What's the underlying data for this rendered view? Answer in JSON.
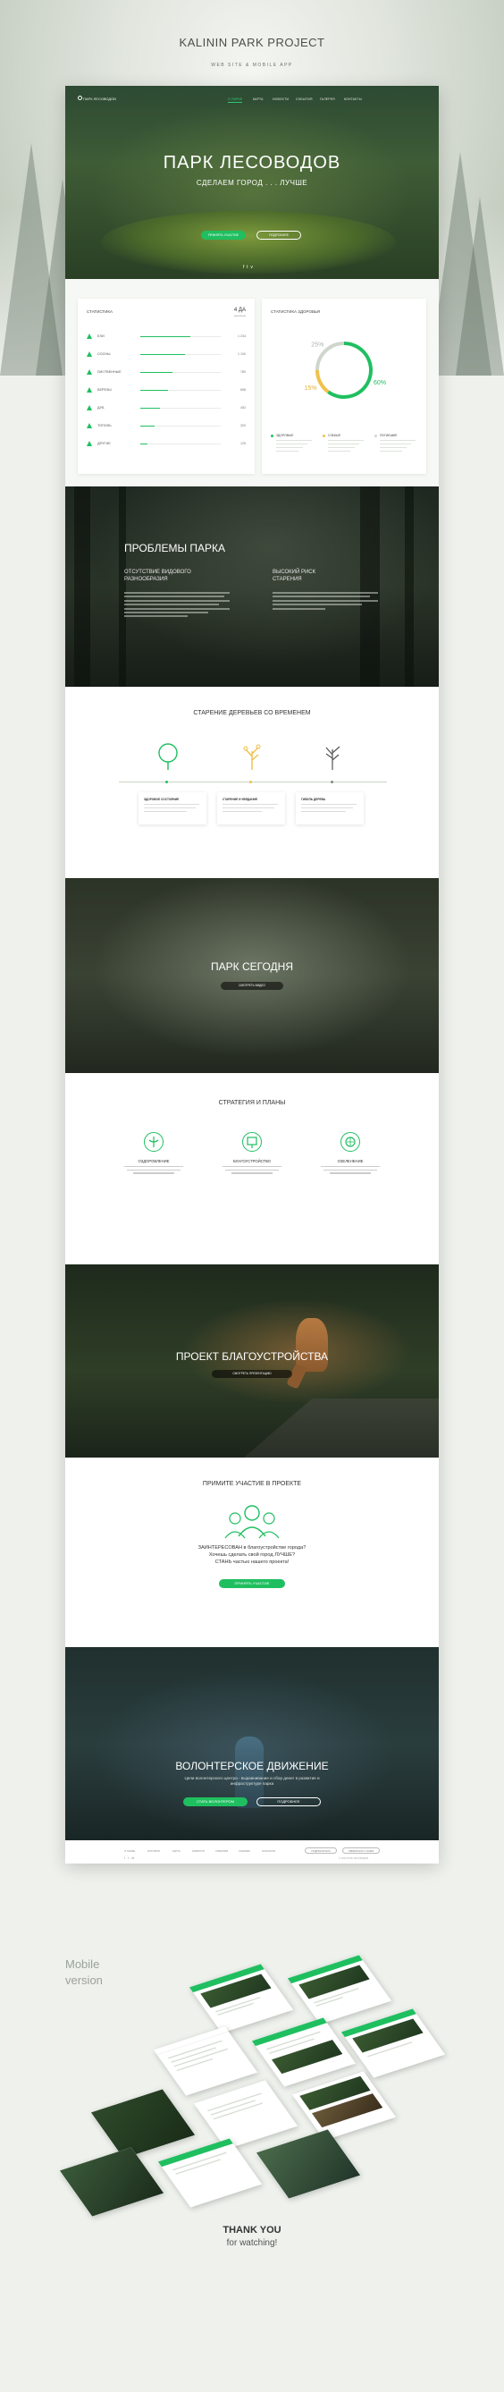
{
  "presentation": {
    "title": "KALININ PARK PROJECT",
    "subtitle": "WEB SITE & MOBILE APP"
  },
  "nav": {
    "logo": "ПАРК ЛЕСОВОДОВ",
    "items": [
      "О ПАРКЕ",
      "КАРТА",
      "НОВОСТИ",
      "СОБЫТИЯ",
      "ГАЛЕРЕЯ",
      "КОНТАКТЫ"
    ],
    "active_index": 0
  },
  "hero": {
    "title": "ПАРК ЛЕСОВОДОВ",
    "subtitle": "СДЕЛАЕМ ГОРОД . . . ЛУЧШЕ",
    "primary_button": "ПРИНЯТЬ УЧАСТИЕ",
    "secondary_button": "ПОДРОБНЕЕ"
  },
  "statistics": {
    "title": "СТАТИСТИКА",
    "total_value": "4 ДА",
    "total_label": "деревьев",
    "rows": [
      {
        "label": "ЕЛИ",
        "value": "1 234",
        "fraction": 0.62
      },
      {
        "label": "СОСНЫ",
        "value": "1 100",
        "fraction": 0.55
      },
      {
        "label": "ЛИСТВЕННЫЕ",
        "value": "789",
        "fraction": 0.4
      },
      {
        "label": "БЕРЕЗЫ",
        "value": "658",
        "fraction": 0.34
      },
      {
        "label": "ДУБ",
        "value": "452",
        "fraction": 0.24
      },
      {
        "label": "ТОПОЛЬ",
        "value": "320",
        "fraction": 0.18
      },
      {
        "label": "ДРУГИЕ",
        "value": "125",
        "fraction": 0.09
      }
    ]
  },
  "health": {
    "title": "СТАТИСТИКА ЗДОРОВЬЯ",
    "segments": [
      {
        "label": "ЗДОРОВЫЕ",
        "percent": 60,
        "display": "60%",
        "color": "#1fbf60"
      },
      {
        "label": "СЛАБЫЕ",
        "percent": 15,
        "display": "15%",
        "color": "#f0c14b"
      },
      {
        "label": "ПОГИБШИЕ",
        "percent": 25,
        "display": "25%",
        "color": "#cfd6cc"
      }
    ]
  },
  "problems": {
    "title": "ПРОБЛЕМЫ ПАРКА",
    "left_heading": "ОТСУТСТВИЕ ВИДОВОГО РАЗНООБРАЗИЯ",
    "right_heading": "ВЫСОКИЙ РИСК СТАРЕНИЯ"
  },
  "aging": {
    "title": "СТАРЕНИЕ ДЕРЕВЬЕВ СО ВРЕМЕНЕМ",
    "cards": [
      {
        "title": "ЗДОРОВОЕ СОСТОЯНИЕ"
      },
      {
        "title": "СТАРЕНИЕ И УВЯДАНИЕ"
      },
      {
        "title": "ГИБЕЛЬ ДЕРЕВА"
      }
    ]
  },
  "today": {
    "title": "ПАРК СЕГОДНЯ",
    "button": "СМОТРЕТЬ ВИДЕО"
  },
  "strategies": {
    "title": "СТРАТЕГИЯ И ПЛАНЫ",
    "items": [
      {
        "title": "ОЗДОРОВЛЕНИЕ"
      },
      {
        "title": "БЛАГОУСТРОЙСТВО"
      },
      {
        "title": "ОЗЕЛЕНЕНИЕ"
      }
    ]
  },
  "project": {
    "title": "ПРОЕКТ БЛАГОУСТРОЙСТВА",
    "button": "СМОТРЕТЬ ПРЕЗЕНТАЦИЮ"
  },
  "participate": {
    "title": "ПРИМИТЕ УЧАСТИЕ В ПРОЕКТЕ",
    "line1": "ЗАИНТЕРЕСОВАН в благоустройстве города?",
    "line2": "Хочешь сделать свой город ЛУЧШЕ?",
    "line3": "СТАНЬ частью нашего проекта!",
    "button": "ПРИНЯТЬ УЧАСТИЕ"
  },
  "volunteers": {
    "title": "ВОЛОНТЕРСКОЕ ДВИЖЕНИЕ",
    "text": "Цели волонтерского центра - выравнивание и сбор денег в развитие и инфраструктуре парка",
    "primary_button": "СТАТЬ ВОЛОНТЕРОМ",
    "secondary_button": "ПОДРОБНЕЕ"
  },
  "footer": {
    "links": [
      "О ПАРКЕ",
      "ИСТОРИЯ",
      "КАРТА",
      "НОВОСТИ",
      "СОБЫТИЯ",
      "ГАЛЕРЕЯ",
      "КОНТАКТЫ"
    ],
    "button1": "ПОДПИСАТЬСЯ",
    "button2": "СВЯЗАТЬСЯ С НАМИ",
    "social": [
      "f",
      "t",
      "vk"
    ],
    "copyright": "© 2016 ПАРК ЛЕСОВОДОВ"
  },
  "mobile": {
    "label_line1": "Mobile",
    "label_line2": "version"
  },
  "thanks": {
    "title": "THANK YOU",
    "subtitle": "for watching!"
  }
}
